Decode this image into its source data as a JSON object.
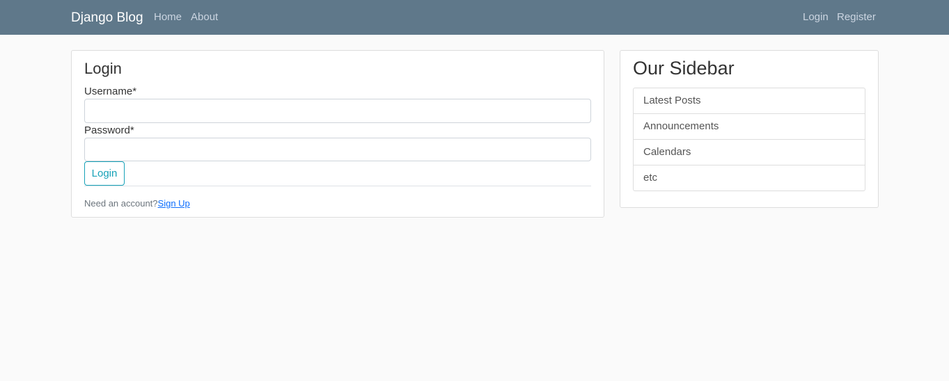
{
  "navbar": {
    "brand": "Django Blog",
    "left_links": [
      "Home",
      "About"
    ],
    "right_links": [
      "Login",
      "Register"
    ]
  },
  "login_card": {
    "title": "Login",
    "username_label": "Username*",
    "username_value": "",
    "password_label": "Password*",
    "password_value": "",
    "submit_label": "Login",
    "footer_text": "Need an account?",
    "signup_link": "Sign Up"
  },
  "sidebar": {
    "title": "Our Sidebar",
    "items": [
      "Latest Posts",
      "Announcements",
      "Calendars",
      "etc"
    ]
  },
  "colors": {
    "navbar_bg": "#5f788a",
    "accent": "#17a2b8",
    "link": "#0d6efd",
    "page_bg": "#fafafa"
  }
}
